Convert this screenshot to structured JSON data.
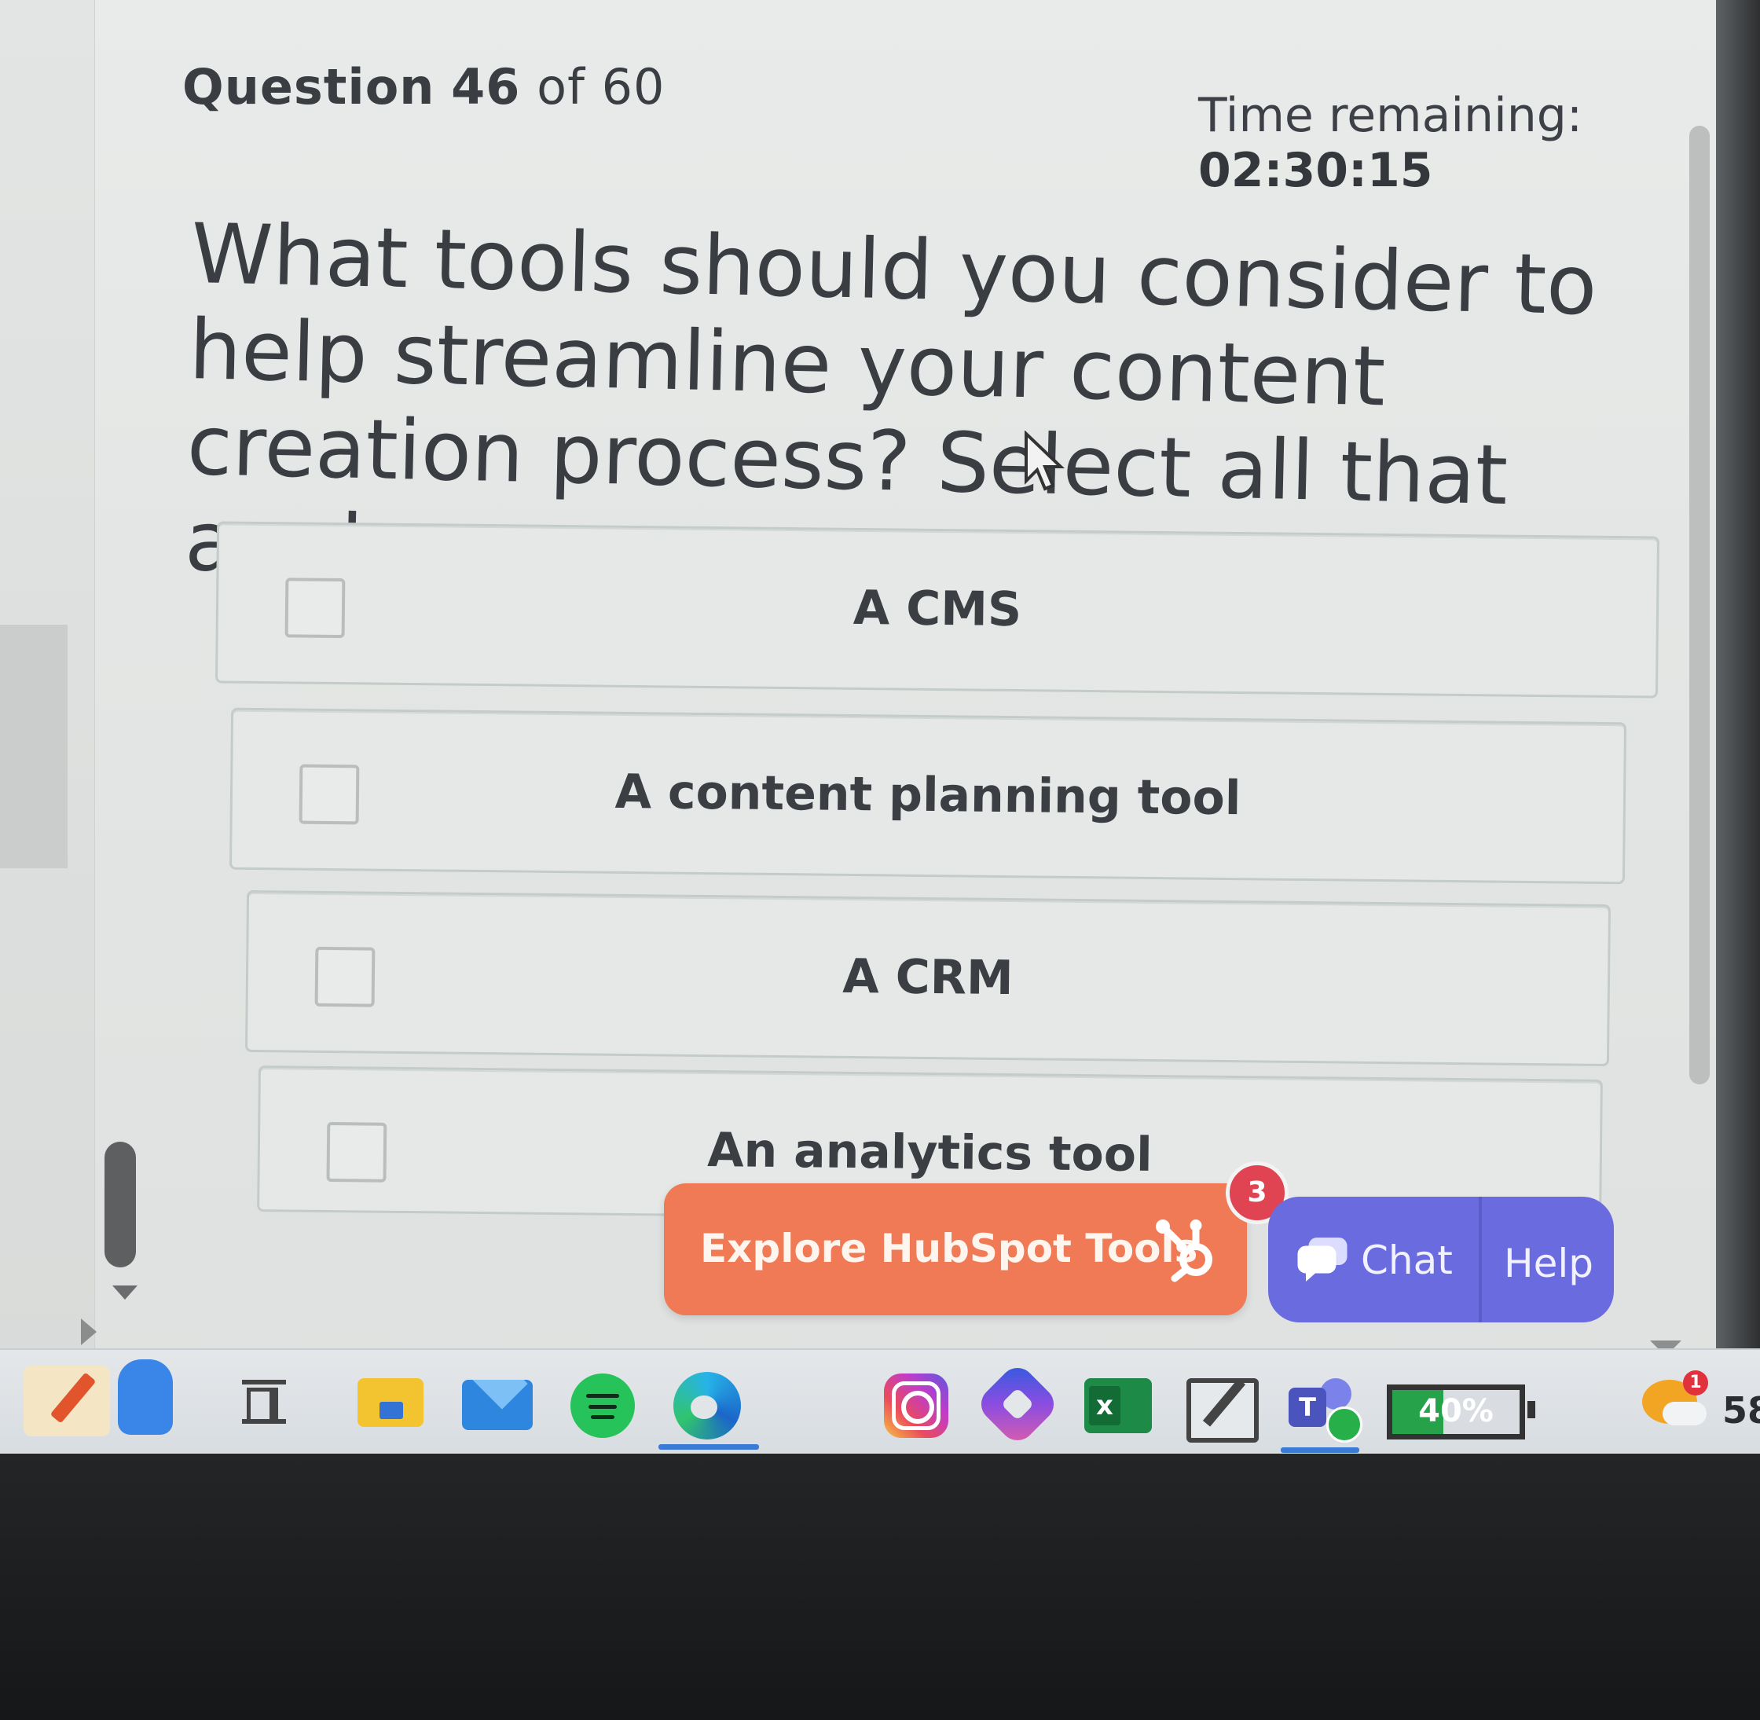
{
  "header": {
    "question_prefix": "Question",
    "question_number": "46",
    "question_of": "of 60",
    "timer_label": "Time remaining:",
    "timer_value": "02:30:15"
  },
  "question": {
    "text": "What tools should you consider to help streamline your content creation process? Select all that apply."
  },
  "options": [
    {
      "label": "A CMS",
      "checked": false
    },
    {
      "label": "A content planning tool",
      "checked": false
    },
    {
      "label": "A CRM",
      "checked": false
    },
    {
      "label": "An analytics tool",
      "checked": false
    }
  ],
  "floating": {
    "hubspot_label": "Explore HubSpot Tools",
    "badge_count": "3",
    "chat_label": "Chat",
    "help_label": "Help"
  },
  "colors": {
    "hubspot_orange": "#ef7a55",
    "chat_purple": "#6b6be0",
    "badge_red": "#e04452"
  },
  "taskbar": {
    "icons": [
      "notes-app-icon",
      "backpack-icon",
      "widgets-icon",
      "file-explorer-icon",
      "mail-icon",
      "spotify-icon",
      "edge-icon",
      "instagram-icon",
      "copilot-icon",
      "excel-icon",
      "edit-app-icon",
      "teams-icon"
    ],
    "battery_percent": "40%",
    "battery_level": 0.4,
    "weather_badge": "1",
    "temperature": "58"
  }
}
